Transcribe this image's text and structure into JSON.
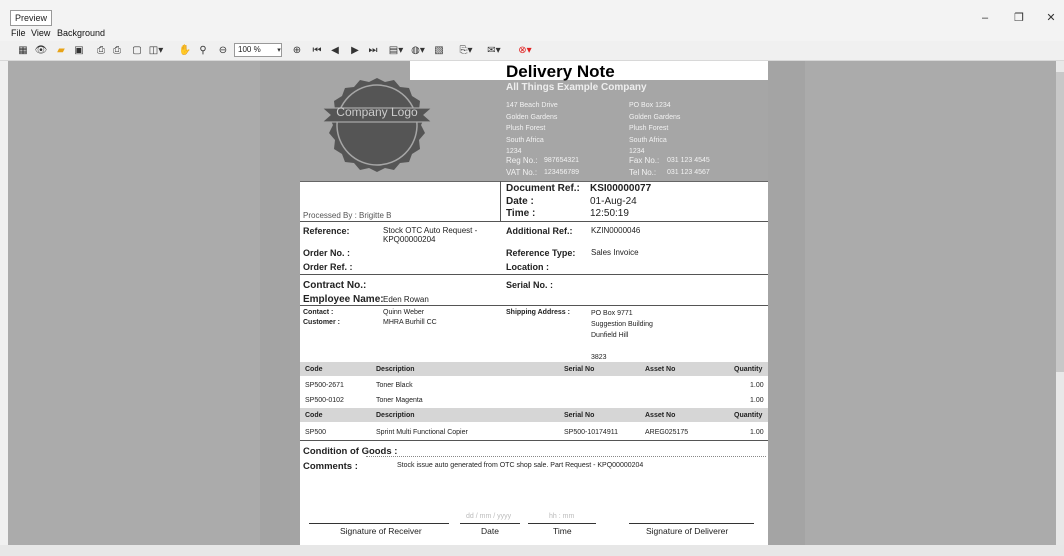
{
  "app": {
    "title": "Preview",
    "minimize": "–",
    "restore": "❐",
    "close": "✕"
  },
  "menu": [
    "File",
    "View",
    "Background"
  ],
  "toolbar": {
    "zoom": "100 %"
  },
  "doc": {
    "title": "Delivery Note",
    "company": "All Things Example Company",
    "logo_text": "Company Logo",
    "addr_left": [
      "147 Beach Drive",
      "Golden Gardens",
      "Plush Forest",
      "South Africa",
      "1234"
    ],
    "addr_right": [
      "PO Box 1234",
      "Golden Gardens",
      "Plush Forest",
      "South Africa",
      "1234"
    ],
    "reg_label": "Reg No.:",
    "reg_value": "987654321",
    "fax_label": "Fax No.:",
    "fax_value": "031 123 4545",
    "vat_label": "VAT No.:",
    "vat_value": "123456789",
    "tel_label": "Tel No.:",
    "tel_value": "031 123 4567",
    "docref_label": "Document Ref.:",
    "docref_value": "KSI00000077",
    "date_label": "Date :",
    "date_value": "01-Aug-24",
    "time_label": "Time :",
    "time_value": "12:50:19",
    "processed_by": "Processed By : Brigitte B",
    "reference_label": "Reference:",
    "reference_value": "Stock OTC Auto Request - KPQ00000204",
    "addref_label": "Additional Ref.:",
    "addref_value": "KZIN0000046",
    "orderno_label": "Order No. :",
    "reftype_label": "Reference Type:",
    "reftype_value": "Sales Invoice",
    "orderref_label": "Order Ref. :",
    "location_label": "Location :",
    "contract_label": "Contract No.:",
    "serial_label": "Serial No. :",
    "employee_label": "Employee Name:",
    "employee_value": "Eden Rowan",
    "contact_label": "Contact :",
    "contact_value": "Quinn Weber",
    "customer_label": "Customer :",
    "customer_value": "MHRA Burhill CC",
    "shipping_label": "Shipping Address :",
    "shipping_lines": [
      "PO Box 9771",
      "Suggestion Building",
      "Dunfield Hill",
      "",
      "3823"
    ],
    "table_headers": [
      "Code",
      "Description",
      "Serial No",
      "Asset No",
      "Quantity"
    ],
    "rows1": [
      [
        "SP500-2671",
        "Toner Black",
        "",
        "",
        "1.00"
      ],
      [
        "SP500-0102",
        "Toner Magenta",
        "",
        "",
        "1.00"
      ]
    ],
    "rows2": [
      [
        "SP500",
        "Sprint Multi Functional Copier",
        "SP500-10174911",
        "AREG025175",
        "1.00"
      ]
    ],
    "condition_label": "Condition of Goods :",
    "comments_label": "Comments :",
    "comments_value": "Stock issue auto generated from OTC shop sale. Part Request - KPQ00000204",
    "date_placeholder": "dd / mm / yyyy",
    "time_placeholder": "hh : mm",
    "sig_receiver": "Signature of Receiver",
    "sig_date": "Date",
    "sig_time": "Time",
    "sig_deliverer": "Signature of Deliverer"
  }
}
